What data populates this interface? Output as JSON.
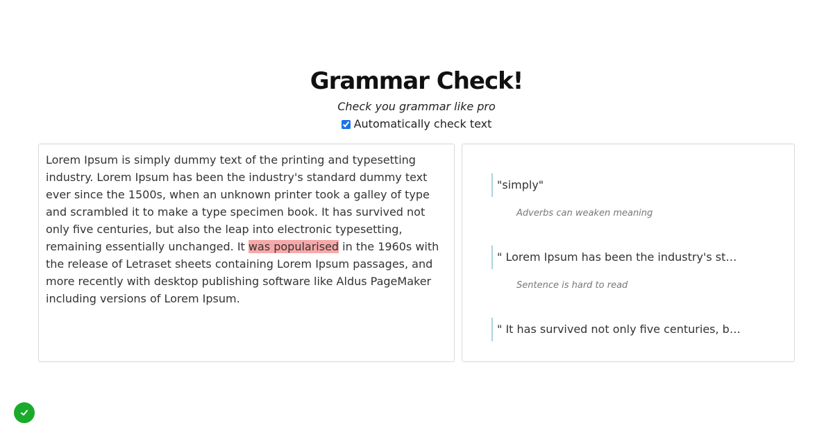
{
  "header": {
    "title": "Grammar Check!",
    "subtitle": "Check you grammar like pro",
    "auto_check_label": "Automatically check text",
    "auto_check_checked": true
  },
  "editor": {
    "text_before": "Lorem Ipsum is simply dummy text of the printing and typesetting industry. Lorem Ipsum has been the industry's standard dummy text ever since the 1500s, when an unknown printer took a galley of type and scrambled it to make a type specimen book. It has survived not only five centuries, but also the leap into electronic typesetting, remaining essentially unchanged. It ",
    "highlighted": "was popularised",
    "text_after": " in the 1960s with the release of Letraset sheets containing Lorem Ipsum passages, and more recently with desktop publishing software like Aldus PageMaker including versions of Lorem Ipsum."
  },
  "results": {
    "issues": [
      {
        "quote": "\"simply\"",
        "message": "Adverbs can weaken meaning"
      },
      {
        "quote": "\" Lorem Ipsum has been the industry's stan...",
        "message": "Sentence is hard to read"
      },
      {
        "quote": "\" It has survived not only five centuries, but ...",
        "message": ""
      }
    ]
  },
  "status": {
    "icon": "checkmark-icon",
    "color": "#1aab2a"
  },
  "colors": {
    "highlight": "#f7a9a9",
    "quote_border": "#a9d3dc"
  }
}
